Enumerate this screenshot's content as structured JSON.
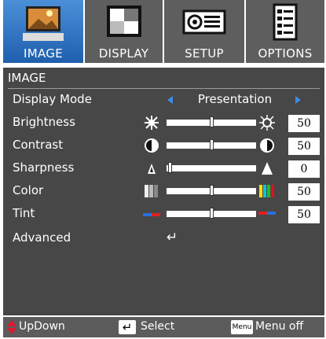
{
  "tabs": [
    {
      "label": "IMAGE",
      "icon": "image-icon",
      "active": true
    },
    {
      "label": "DISPLAY",
      "icon": "display-icon",
      "active": false
    },
    {
      "label": "SETUP",
      "icon": "projector-icon",
      "active": false
    },
    {
      "label": "OPTIONS",
      "icon": "options-icon",
      "active": false
    }
  ],
  "panel": {
    "title": "IMAGE",
    "display_mode": {
      "label": "Display Mode",
      "value": "Presentation"
    },
    "sliders": [
      {
        "label": "Brightness",
        "value": "50",
        "level": 0.5,
        "left_icon": "sun-small-icon",
        "right_icon": "sun-large-icon"
      },
      {
        "label": "Contrast",
        "value": "50",
        "level": 0.5,
        "left_icon": "contrast-icon",
        "right_icon": "contrast-icon"
      },
      {
        "label": "Sharpness",
        "value": "0",
        "level": 0.0,
        "left_icon": "sharpness-low-icon",
        "right_icon": "sharpness-high-icon"
      },
      {
        "label": "Color",
        "value": "50",
        "level": 0.5,
        "left_icon": "color-bars-low-icon",
        "right_icon": "color-bars-high-icon"
      },
      {
        "label": "Tint",
        "value": "50",
        "level": 0.5,
        "left_icon": "tint-left-icon",
        "right_icon": "tint-right-icon"
      }
    ],
    "advanced": {
      "label": "Advanced",
      "icon": "enter-icon"
    }
  },
  "footer": {
    "updown_label": "UpDown",
    "select_label": "Select",
    "menu_key": "Menu",
    "menuoff_label": "Menu off"
  },
  "colors": {
    "active_tab": "#2f74c8",
    "panel": "#474747",
    "accent_arrow": "#3f8ae6"
  }
}
